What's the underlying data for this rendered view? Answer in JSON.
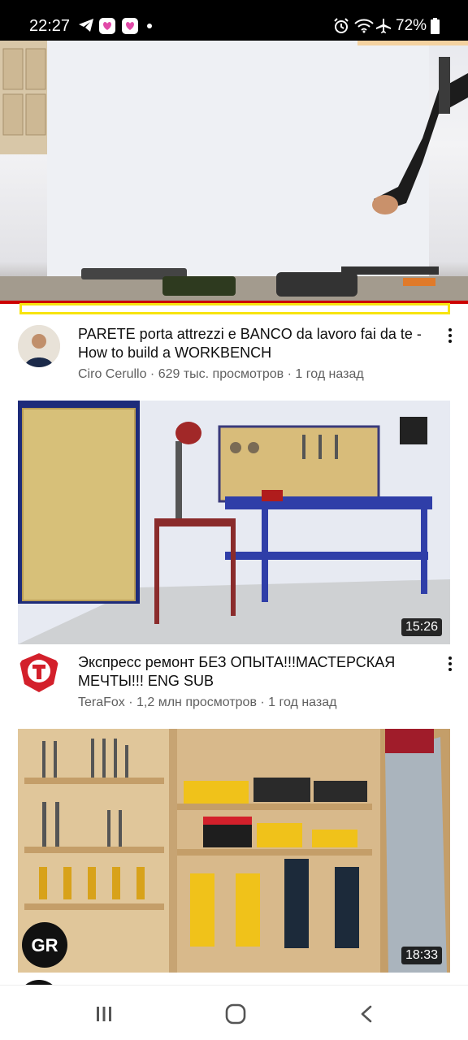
{
  "status_bar": {
    "time": "22:27",
    "icons_left": [
      "telegram-icon",
      "likee-icon",
      "likee-icon",
      "dot-icon"
    ],
    "icons_right": [
      "alarm-icon",
      "wifi-icon",
      "airplane-icon"
    ],
    "battery": "72%"
  },
  "videos": [
    {
      "title": "PARETE porta attrezzi e BANCO da lavoro fai da te - How to build a WORKBENCH",
      "meta": "Ciro Cerullo · 629 тыс. просмотров · 1 год назад"
    },
    {
      "title": "Экспресс ремонт БЕЗ ОПЫТА!!!МАСТЕРСКАЯ МЕЧТЫ!!! ENG SUB",
      "meta": "TeraFox · 1,2 млн просмотров · 1 год назад",
      "duration": "15:26"
    },
    {
      "duration": "18:33"
    }
  ],
  "nav": {
    "buttons": [
      "recents-button",
      "home-button",
      "back-button"
    ]
  },
  "colors": {
    "progress_red": "#cc0000",
    "scrub_yellow": "#f7e40f",
    "meta_gray": "#606060"
  }
}
